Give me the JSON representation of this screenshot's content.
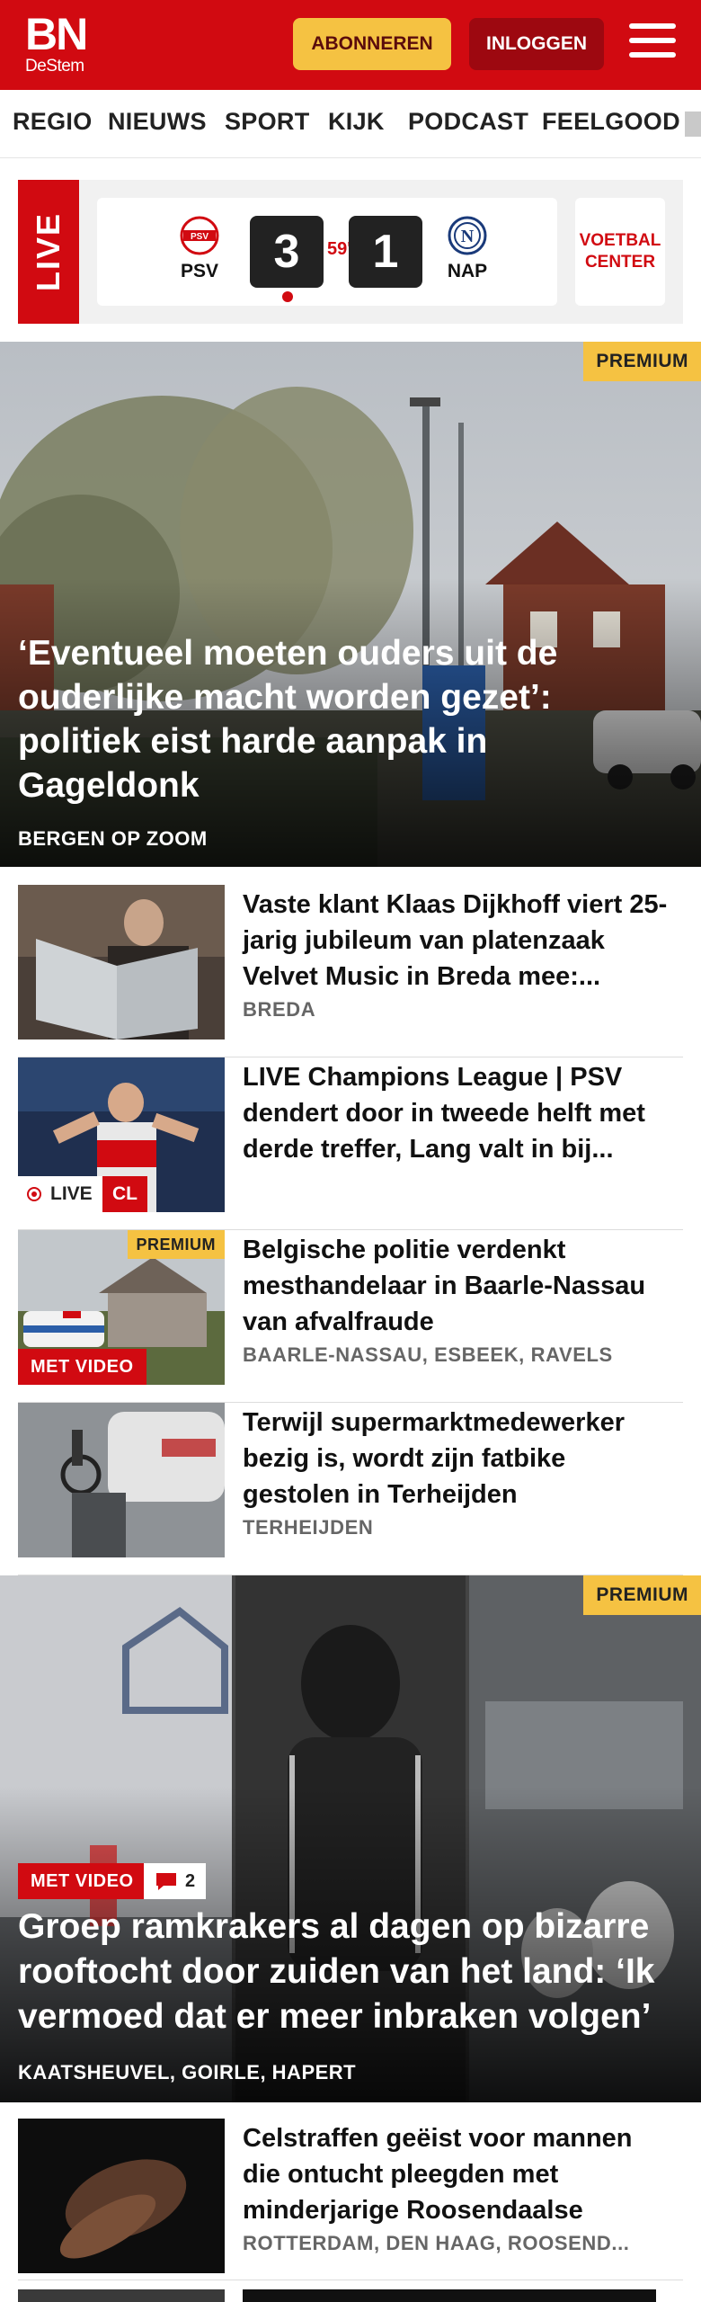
{
  "header": {
    "logo_top": "BN",
    "logo_bottom": "DeStem",
    "subscribe_label": "ABONNEREN",
    "login_label": "INLOGGEN",
    "brand_color": "#d10a11",
    "accent_color": "#f5c242"
  },
  "nav": {
    "items": [
      "REGIO",
      "NIEUWS",
      "SPORT",
      "KIJK",
      "PODCAST",
      "FEELGOOD"
    ]
  },
  "live": {
    "tag": "LIVE",
    "home_team": "PSV",
    "home_score": "3",
    "minute": "59'",
    "away_score": "1",
    "away_team": "NAP",
    "home_crest_text": "PSV",
    "away_crest_text": "N",
    "center_label_1": "VOETBAL",
    "center_label_2": "CENTER"
  },
  "hero": {
    "premium": "PREMIUM",
    "title": "‘Eventueel moeten ouders uit de ouderlijke macht worden gezet’: politiek eist harde aanpak in Gageldonk",
    "location": "BERGEN OP ZOOM"
  },
  "articles": [
    {
      "title": "Vaste klant Klaas Dijkhoff viert 25-jarig jubileum van platenzaak Velvet Music in Breda mee:...",
      "location": "BREDA"
    },
    {
      "title": "LIVE Champions League | PSV dendert door in tweede helft met derde treffer, Lang valt in bij...",
      "live_label": "LIVE",
      "cl_label": "CL"
    },
    {
      "title": "Belgische politie verdenkt mesthandelaar in Baarle-Nassau van afvalfraude",
      "location": "BAARLE-NASSAU, ESBEEK, RAVELS",
      "premium": "PREMIUM",
      "video_label": "MET VIDEO"
    },
    {
      "title": "Terwijl supermarktmedewerker bezig is, wordt zijn fatbike gestolen in Terheijden",
      "location": "TERHEIJDEN"
    }
  ],
  "hero2": {
    "premium": "PREMIUM",
    "video_label": "MET VIDEO",
    "comment_count": "2",
    "title": "Groep ramkrakers al dagen op bizarre rooftocht door zuiden van het land: ‘Ik vermoed dat er meer inbraken volgen’",
    "location": "KAATSHEUVEL, GOIRLE, HAPERT"
  },
  "articles2": [
    {
      "title": "Celstraffen geëist voor mannen die ontucht pleegden met minderjarige Roosendaalse",
      "location": "ROTTERDAM, DEN HAAG, ROOSEND..."
    }
  ]
}
